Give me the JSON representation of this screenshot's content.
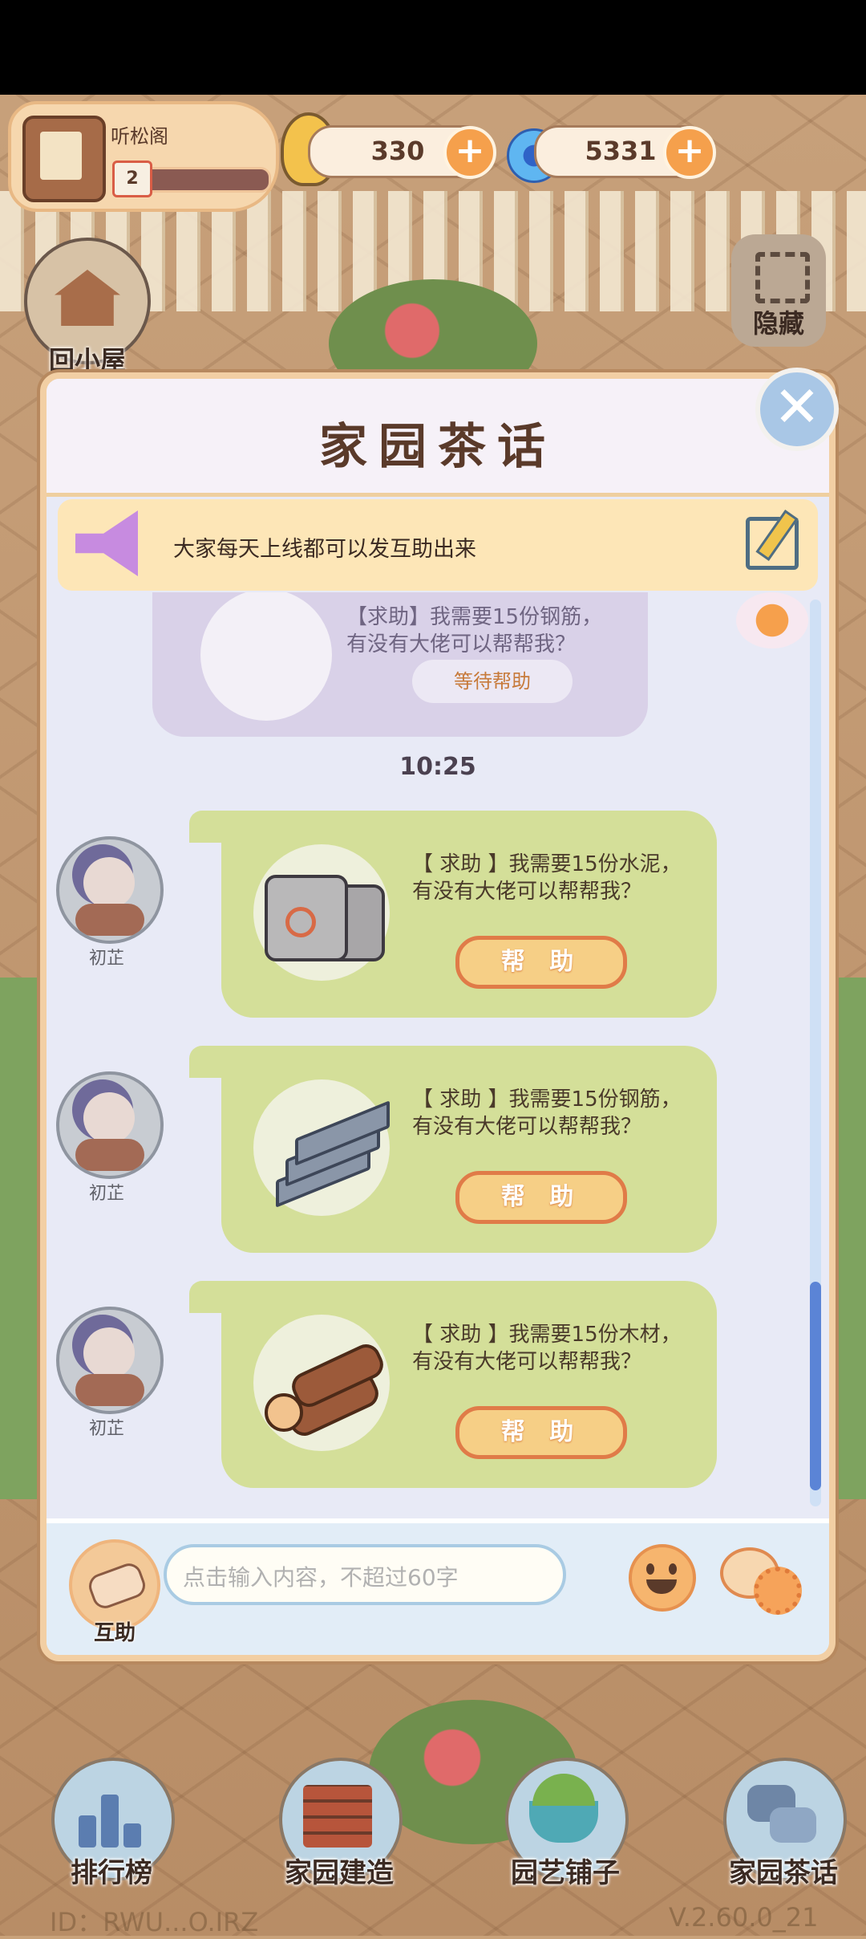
{
  "hud": {
    "player_name": "听松阁",
    "level": "2",
    "coins": "330",
    "gems": "5331"
  },
  "side_buttons": {
    "home_label": "回小屋",
    "hide_label": "隐藏"
  },
  "modal": {
    "title": "家园茶话",
    "notice": "大家每天上线都可以发互助出来",
    "previous_message": {
      "text_line1": "【求助】我需要15份钢筋，",
      "text_line2": "有没有大佬可以帮帮我？",
      "status_button": "等待帮助"
    },
    "timestamp": "10:25",
    "messages": [
      {
        "user": "初芷",
        "line1": "【 求助 】我需要15份水泥，",
        "line2": "有没有大佬可以帮帮我？",
        "button": "帮 助",
        "item_icon": "cement-bags-icon"
      },
      {
        "user": "初芷",
        "line1": "【 求助 】我需要15份钢筋，",
        "line2": "有没有大佬可以帮帮我？",
        "button": "帮 助",
        "item_icon": "steel-beams-icon"
      },
      {
        "user": "初芷",
        "line1": "【 求助 】我需要15份木材，",
        "line2": "有没有大佬可以帮帮我？",
        "button": "帮 助",
        "item_icon": "wood-logs-icon"
      }
    ],
    "footer": {
      "mutual_label": "互助",
      "input_placeholder": "点击输入内容，不超过60字"
    }
  },
  "bottom_nav": [
    {
      "label": "排行榜",
      "icon": "leaderboard-icon"
    },
    {
      "label": "家园建造",
      "icon": "brick-wall-icon"
    },
    {
      "label": "园艺铺子",
      "icon": "flower-basket-icon"
    },
    {
      "label": "家园茶话",
      "icon": "chat-bubbles-icon"
    }
  ],
  "footer_text": {
    "id": "ID：RWU...O.IRZ",
    "version": "V.2.60.0_21"
  },
  "colors": {
    "help_button": "#f6cf86",
    "message_bubble": "#d4df99",
    "modal_bg": "#e8eaf6",
    "notice_bg": "#fde6b7"
  }
}
